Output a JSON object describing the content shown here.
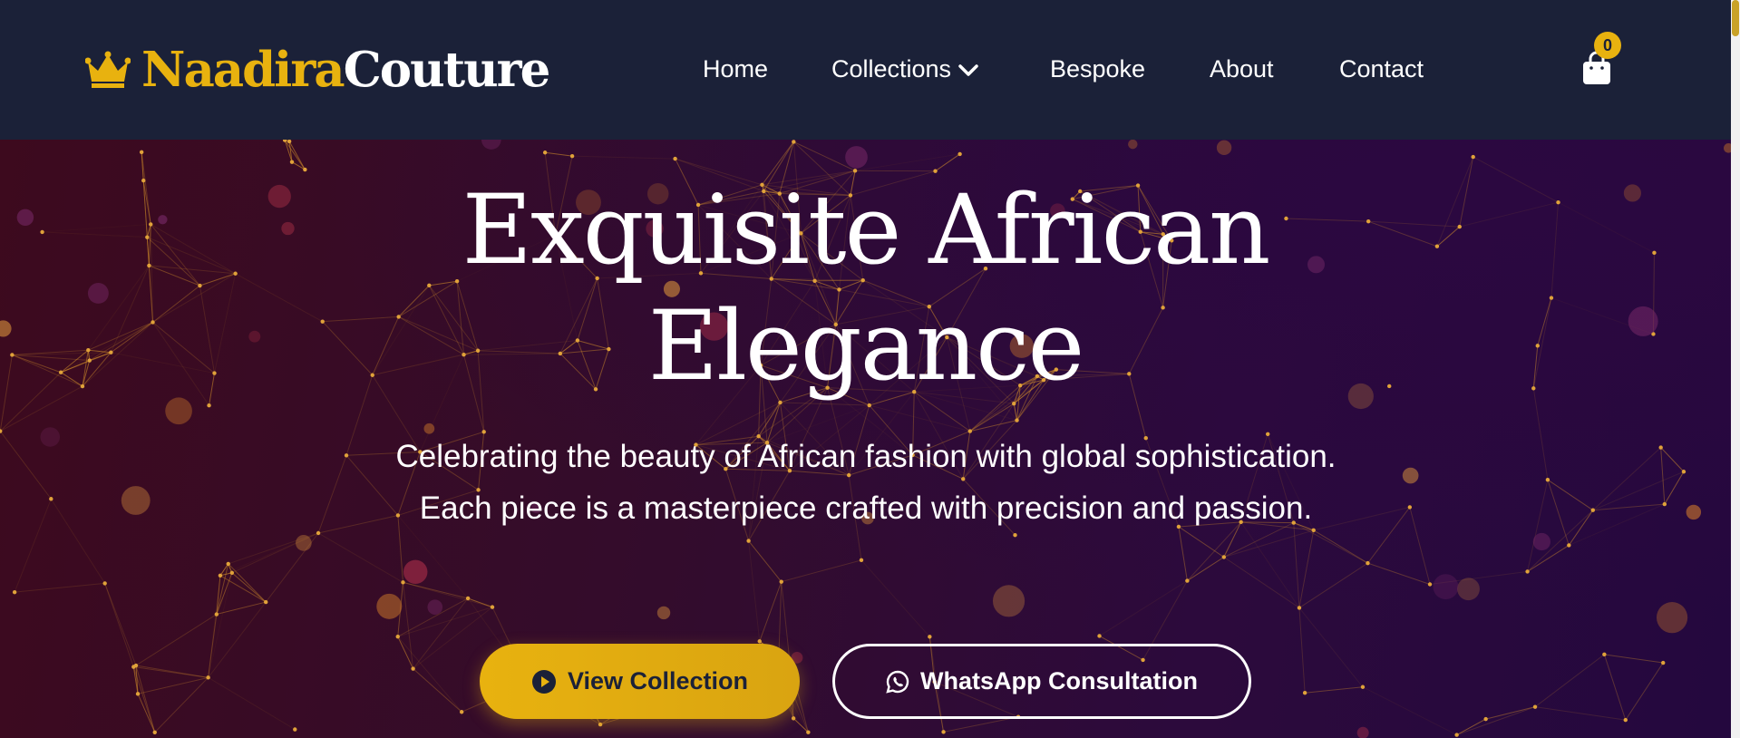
{
  "brand": {
    "name_part1": "Naadira",
    "name_part2": "Couture",
    "logo_icon": "crown-icon"
  },
  "nav": {
    "items": [
      {
        "label": "Home"
      },
      {
        "label": "Collections",
        "has_dropdown": true
      },
      {
        "label": "Bespoke"
      },
      {
        "label": "About"
      },
      {
        "label": "Contact"
      }
    ],
    "cart_icon": "shopping-bag-icon",
    "cart_count": "0"
  },
  "hero": {
    "title_line1": "Exquisite African",
    "title_line2": "Elegance",
    "subtitle": "Celebrating the beauty of African fashion with global sophistication. Each piece is a masterpiece crafted with precision and passion.",
    "primary_button": {
      "label": "View Collection",
      "icon": "play-circle-icon"
    },
    "secondary_button": {
      "label": "WhatsApp Consultation",
      "icon": "whatsapp-icon"
    }
  },
  "colors": {
    "navbar_bg": "#1b2138",
    "accent_gold": "#e8b20f",
    "hero_bg_start": "#3d0a1e",
    "hero_bg_end": "#24083e"
  }
}
